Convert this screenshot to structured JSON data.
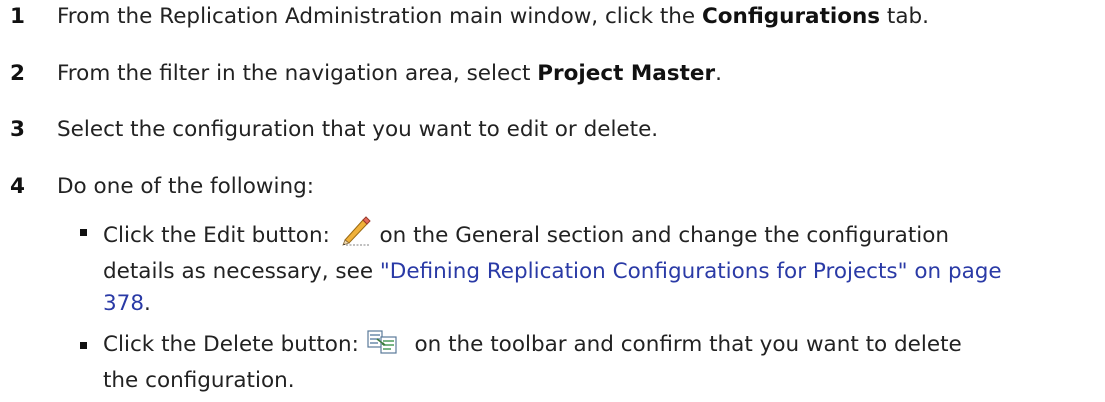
{
  "steps": [
    {
      "number": "1",
      "parts": [
        "From the Replication Administration main window, click the ",
        "Configurations",
        " tab."
      ]
    },
    {
      "number": "2",
      "parts": [
        "From the filter in the navigation area, select ",
        "Project Master",
        "."
      ]
    },
    {
      "number": "3",
      "text": "Select the configuration that you want to edit or delete."
    },
    {
      "number": "4",
      "text": "Do one of the following:"
    }
  ],
  "bullets": [
    {
      "before_icon": "Click the Edit button:",
      "icon": "pencil-icon",
      "after_icon": "on the General section and change the configuration",
      "line2_prefix": "details as necessary, see ",
      "link_line2": "\"Defining Replication Configurations for Projects\" on page",
      "link_line3": "378",
      "end": "."
    },
    {
      "before_icon": "Click the Delete button:",
      "icon": "delete-config-icon",
      "after_icon": "on the toolbar and confirm that you want to delete",
      "line2": "the configuration."
    }
  ],
  "colors": {
    "text": "#222222",
    "link": "#2a3aa6"
  }
}
